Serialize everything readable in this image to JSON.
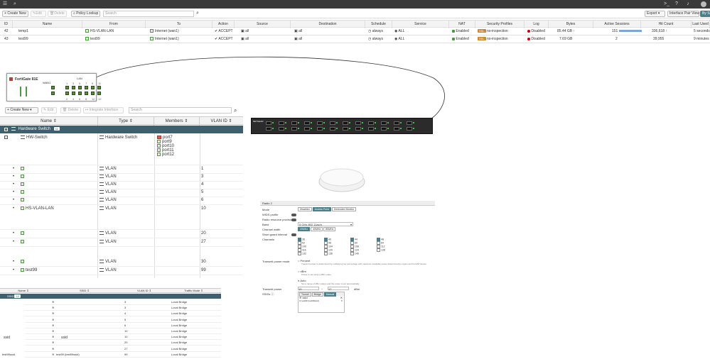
{
  "policy": {
    "toolbar": {
      "create_new": "Create New",
      "edit": "Edit",
      "delete": "Delete",
      "policy_lookup": "Policy Lookup",
      "search_placeholder": "Search",
      "export": "Export",
      "interface_pair_view": "Interface Pair View",
      "by_sequence": "By Se"
    },
    "columns": [
      "ID",
      "Name",
      "From",
      "To",
      "Action",
      "Source",
      "Destination",
      "Schedule",
      "Service",
      "NAT",
      "Security Profiles",
      "Log",
      "Bytes",
      "Active Sessions",
      "Hit Count",
      "Last Used"
    ],
    "rows": [
      {
        "id": "42",
        "name": "temp1",
        "from": "HS-VLAN-LAN",
        "to": "Internet (wan1)",
        "action": "ACCEPT",
        "source": "all",
        "destination": "all",
        "schedule": "always",
        "service": "ALL",
        "nat": "Enabled",
        "ssl_tag": "SSL",
        "profile": "no-inspection",
        "log": "Disabled",
        "bytes": "85.44 GB",
        "bytes_arrow": "↑",
        "sessions": "151",
        "hits": "336,618",
        "hits_arrow": "↑",
        "last_used": "5 seconds a"
      },
      {
        "id": "43",
        "name": "test99",
        "from": "test99",
        "to": "Internet (wan1)",
        "action": "ACCEPT",
        "source": "all",
        "destination": "all",
        "schedule": "always",
        "service": "ALL",
        "nat": "Enabled",
        "ssl_tag": "SSL",
        "profile": "no-inspection",
        "log": "Disabled",
        "bytes": "7.69 GB",
        "bytes_arrow": "",
        "sessions": "2",
        "hits": "39,955",
        "hits_arrow": "",
        "last_used": "9 minutes a"
      }
    ]
  },
  "fortigate": {
    "model": "FortiGate 81E",
    "wan_label": "WAN1",
    "lan_label": "LAN",
    "port_numbers": [
      "1",
      "3",
      "5",
      "7",
      "9",
      "11",
      "2",
      "4",
      "6",
      "8",
      "10",
      "12"
    ],
    "port_active": [
      true,
      true,
      true,
      true,
      true,
      true,
      true,
      true,
      true,
      true,
      true,
      true
    ]
  },
  "interfaces": {
    "toolbar": {
      "create_new": "Create New",
      "edit": "Edit",
      "delete": "Delete",
      "integrate": "Integrate Interface",
      "search_placeholder": "Search"
    },
    "columns": {
      "name": "Name",
      "type": "Type",
      "members": "Members",
      "vlan_id": "VLAN ID"
    },
    "group_label": "Hardware Switch",
    "group_count": "11",
    "hw_switch": {
      "name": "HW-Switch",
      "type": "Hardware Switch",
      "members": [
        "port7",
        "port9",
        "port10",
        "port11",
        "port12"
      ]
    },
    "rows": [
      {
        "name": "",
        "type": "VLAN",
        "vlan": "1"
      },
      {
        "name": "",
        "type": "VLAN",
        "vlan": "3"
      },
      {
        "name": "",
        "type": "VLAN",
        "vlan": "4"
      },
      {
        "name": "",
        "type": "VLAN",
        "vlan": "5"
      },
      {
        "name": "",
        "type": "VLAN",
        "vlan": "6"
      },
      {
        "name": "HS-VLAN-LAN",
        "type": "VLAN",
        "vlan": "10"
      },
      {
        "name": "",
        "type": "VLAN",
        "vlan": "20"
      },
      {
        "name": "",
        "type": "VLAN",
        "vlan": "27"
      },
      {
        "name": "",
        "type": "VLAN",
        "vlan": "30"
      },
      {
        "name": "test99",
        "type": "VLAN",
        "vlan": "99"
      }
    ]
  },
  "switch": {
    "brand": "NETGEAR"
  },
  "radio": {
    "header": "Radio 2",
    "mode_label": "Mode",
    "modes": [
      "Disabled",
      "Access Point",
      "Dedicated Monitor"
    ],
    "wids_label": "WIDS profile",
    "rrp_label": "Radio resource provision",
    "band_label": "Band",
    "band_value": "5 GHz   802.11ac/n",
    "chwidth_label": "Channel width",
    "chwidths": [
      "20MHz",
      "40MHz",
      "80MHz"
    ],
    "sgi_label": "Short guard interval",
    "channels_label": "Channels",
    "channels": [
      "36",
      "40",
      "44",
      "48",
      "52",
      "56",
      "60",
      "64",
      "100",
      "104",
      "108",
      "112",
      "116",
      "120",
      "124",
      "128",
      "132",
      "136",
      "140"
    ],
    "tx_mode_label": "Transmit power mode",
    "tx_opt1": "Percent",
    "tx_opt1_desc": "Transmit power is determined by multiplying set percentage with maximum available power determined by region and FortiAP device.",
    "tx_opt2": "dBm",
    "tx_opt2_desc": "Power is set using a dBm value.",
    "tx_opt3": "Auto",
    "tx_opt3_desc": "Set a range of dBm values and the power is set automatically.",
    "tx_power_label": "Transmit power",
    "tx_min": "10",
    "tx_max": "17",
    "tx_unit": "dBm",
    "ssids_label": "SSIDs",
    "ssid_modes": [
      "Tunnel",
      "Bridge",
      "Manual"
    ],
    "ssid_items": [
      "ssid",
      "test99 (test99ssid)"
    ]
  },
  "ssid_table": {
    "columns": {
      "name": "Name",
      "ssid": "SSID",
      "vlan": "VLAN ID",
      "traffic": "Traffic Mode"
    },
    "group_label": "SSID",
    "group_count": "12",
    "side_label_1": "ssid",
    "side_label_2": "ssid",
    "side_label_3": "test99ssid",
    "rows": [
      {
        "ssid": "",
        "vlan": "3",
        "mode": "Local Bridge"
      },
      {
        "ssid": "",
        "vlan": "3",
        "mode": "Local Bridge"
      },
      {
        "ssid": "",
        "vlan": "4",
        "mode": "Local Bridge"
      },
      {
        "ssid": "",
        "vlan": "5",
        "mode": "Local Bridge"
      },
      {
        "ssid": "",
        "vlan": "6",
        "mode": "Local Bridge"
      },
      {
        "ssid": "",
        "vlan": "10",
        "mode": "Local Bridge"
      },
      {
        "ssid": "",
        "vlan": "10",
        "mode": "Local Bridge"
      },
      {
        "ssid": "",
        "vlan": "20",
        "mode": "Local Bridge"
      },
      {
        "ssid": "",
        "vlan": "27",
        "mode": "Local Bridge"
      },
      {
        "ssid": "test99 (test99ssid)",
        "vlan": "99",
        "mode": "Local Bridge"
      }
    ]
  }
}
